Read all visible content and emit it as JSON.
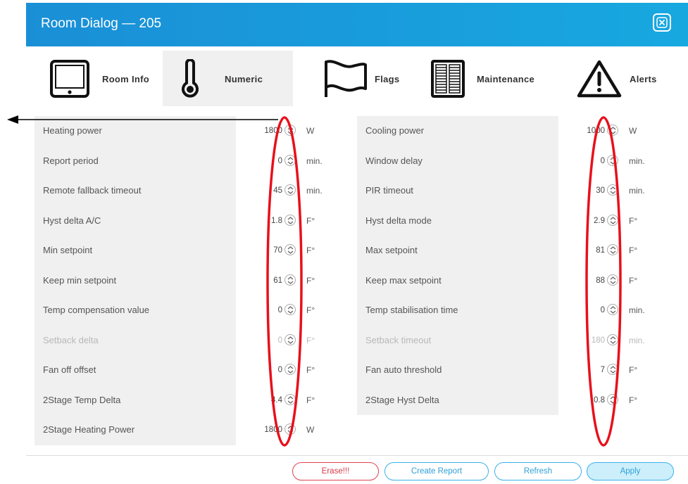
{
  "window": {
    "title": "Room Dialog — 205",
    "close_icon": "close-icon"
  },
  "tabs": [
    {
      "label": "Room Info",
      "icon": "tablet-icon",
      "active": false
    },
    {
      "label": "Numeric",
      "icon": "thermometer-icon",
      "active": true
    },
    {
      "label": "Flags",
      "icon": "flag-icon",
      "active": false
    },
    {
      "label": "Maintenance",
      "icon": "panel-icon",
      "active": false
    },
    {
      "label": "Alerts",
      "icon": "warning-icon",
      "active": false
    }
  ],
  "left_fields": [
    {
      "label": "Heating power",
      "value": "1800",
      "unit": "W",
      "disabled": false
    },
    {
      "label": "Report period",
      "value": "0",
      "unit": "min.",
      "disabled": false
    },
    {
      "label": "Remote fallback timeout",
      "value": "45",
      "unit": "min.",
      "disabled": false
    },
    {
      "label": "Hyst delta A/C",
      "value": "1.8",
      "unit": "F°",
      "disabled": false
    },
    {
      "label": "Min setpoint",
      "value": "70",
      "unit": "F°",
      "disabled": false
    },
    {
      "label": "Keep min setpoint",
      "value": "61",
      "unit": "F°",
      "disabled": false
    },
    {
      "label": "Temp compensation value",
      "value": "0",
      "unit": "F°",
      "disabled": false
    },
    {
      "label": "Setback delta",
      "value": "0",
      "unit": "F°",
      "disabled": true
    },
    {
      "label": "Fan off offset",
      "value": "0",
      "unit": "F°",
      "disabled": false
    },
    {
      "label": "2Stage Temp Delta",
      "value": "4.4",
      "unit": "F°",
      "disabled": false
    },
    {
      "label": "2Stage Heating Power",
      "value": "1800",
      "unit": "W",
      "disabled": false
    }
  ],
  "right_fields": [
    {
      "label": "Cooling power",
      "value": "1000",
      "unit": "W",
      "disabled": false
    },
    {
      "label": "Window delay",
      "value": "0",
      "unit": "min.",
      "disabled": false
    },
    {
      "label": "PIR timeout",
      "value": "30",
      "unit": "min.",
      "disabled": false
    },
    {
      "label": "Hyst delta mode",
      "value": "2.9",
      "unit": "F°",
      "disabled": false
    },
    {
      "label": "Max setpoint",
      "value": "81",
      "unit": "F°",
      "disabled": false
    },
    {
      "label": "Keep max setpoint",
      "value": "88",
      "unit": "F°",
      "disabled": false
    },
    {
      "label": "Temp stabilisation time",
      "value": "0",
      "unit": "min.",
      "disabled": false
    },
    {
      "label": "Setback timeout",
      "value": "180",
      "unit": "min.",
      "disabled": true
    },
    {
      "label": "Fan auto threshold",
      "value": "7",
      "unit": "F°",
      "disabled": false
    },
    {
      "label": "2Stage Hyst Delta",
      "value": "0.8",
      "unit": "F°",
      "disabled": false
    }
  ],
  "footer": {
    "erase_label": "Erase!!!",
    "report_label": "Create Report",
    "refresh_label": "Refresh",
    "apply_label": "Apply"
  },
  "colors": {
    "titlebar": "#1a8fd6",
    "annotation": "#e8101b",
    "erase": "#e0404f",
    "accent": "#3ab0e8"
  }
}
